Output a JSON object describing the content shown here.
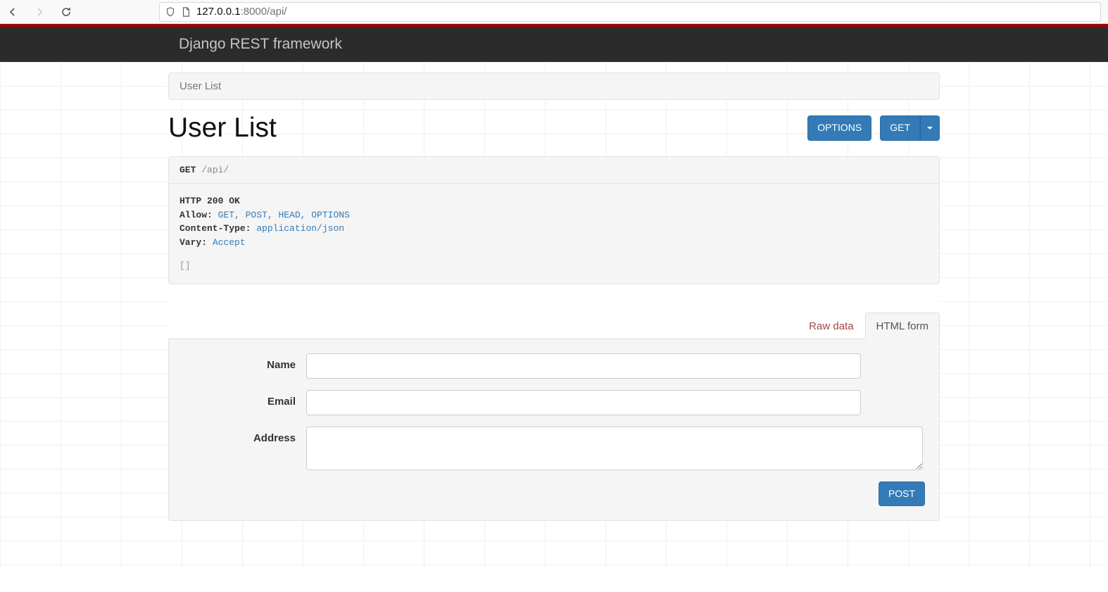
{
  "browser": {
    "url_host": "127.0.0.1",
    "url_port": ":8000",
    "url_path": "/api/"
  },
  "header": {
    "brand": "Django REST framework"
  },
  "breadcrumb": {
    "label": "User List"
  },
  "page": {
    "title": "User List"
  },
  "buttons": {
    "options": "OPTIONS",
    "get": "GET",
    "post": "POST"
  },
  "request": {
    "method": "GET",
    "path": "/api/"
  },
  "response": {
    "status": "HTTP 200 OK",
    "headers": [
      {
        "key": "Allow:",
        "value": "GET, POST, HEAD, OPTIONS"
      },
      {
        "key": "Content-Type:",
        "value": "application/json"
      },
      {
        "key": "Vary:",
        "value": "Accept"
      }
    ],
    "body": "[]"
  },
  "tabs": {
    "raw": "Raw data",
    "html_form": "HTML form"
  },
  "form": {
    "name": {
      "label": "Name",
      "value": ""
    },
    "email": {
      "label": "Email",
      "value": ""
    },
    "address": {
      "label": "Address",
      "value": ""
    }
  }
}
